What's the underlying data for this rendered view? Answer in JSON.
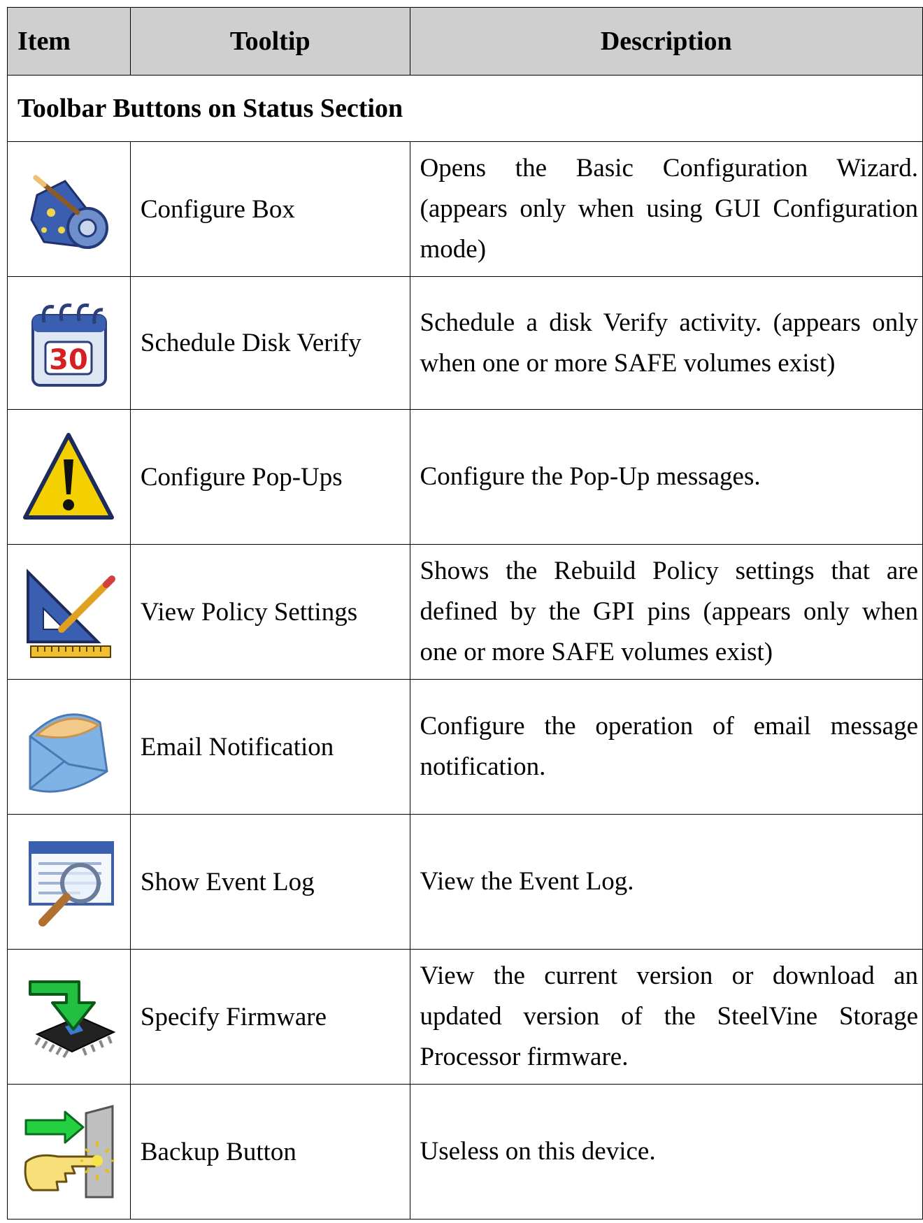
{
  "table": {
    "headers": {
      "item": "Item",
      "tooltip": "Tooltip",
      "description": "Description"
    },
    "section_title": "Toolbar Buttons on Status Section",
    "rows": [
      {
        "icon": "configure-box-icon",
        "tooltip": "Configure Box",
        "description": "Opens the Basic Configuration Wizard. (appears only when using GUI Configuration mode)"
      },
      {
        "icon": "calendar-icon",
        "icon_text": "30",
        "tooltip": "Schedule Disk Verify",
        "description": "Schedule a disk Verify activity. (appears only when one or more SAFE volumes exist)"
      },
      {
        "icon": "warning-icon",
        "tooltip": "Configure Pop-Ups",
        "description": "Configure the Pop-Up messages."
      },
      {
        "icon": "policy-settings-icon",
        "tooltip": "View Policy Settings",
        "description": "Shows the Rebuild Policy settings that are defined by the GPI pins (appears only when one or more SAFE volumes exist)"
      },
      {
        "icon": "envelope-icon",
        "tooltip": "Email Notification",
        "description": "Configure the operation of email message notification."
      },
      {
        "icon": "event-log-icon",
        "tooltip": "Show Event Log",
        "description": "View the Event Log."
      },
      {
        "icon": "firmware-chip-icon",
        "tooltip": "Specify Firmware",
        "description": "View the current version or download an updated version of the SteelVine Storage Processor firmware."
      },
      {
        "icon": "backup-button-icon",
        "tooltip": "Backup Button",
        "description": "Useless on this device."
      }
    ]
  }
}
